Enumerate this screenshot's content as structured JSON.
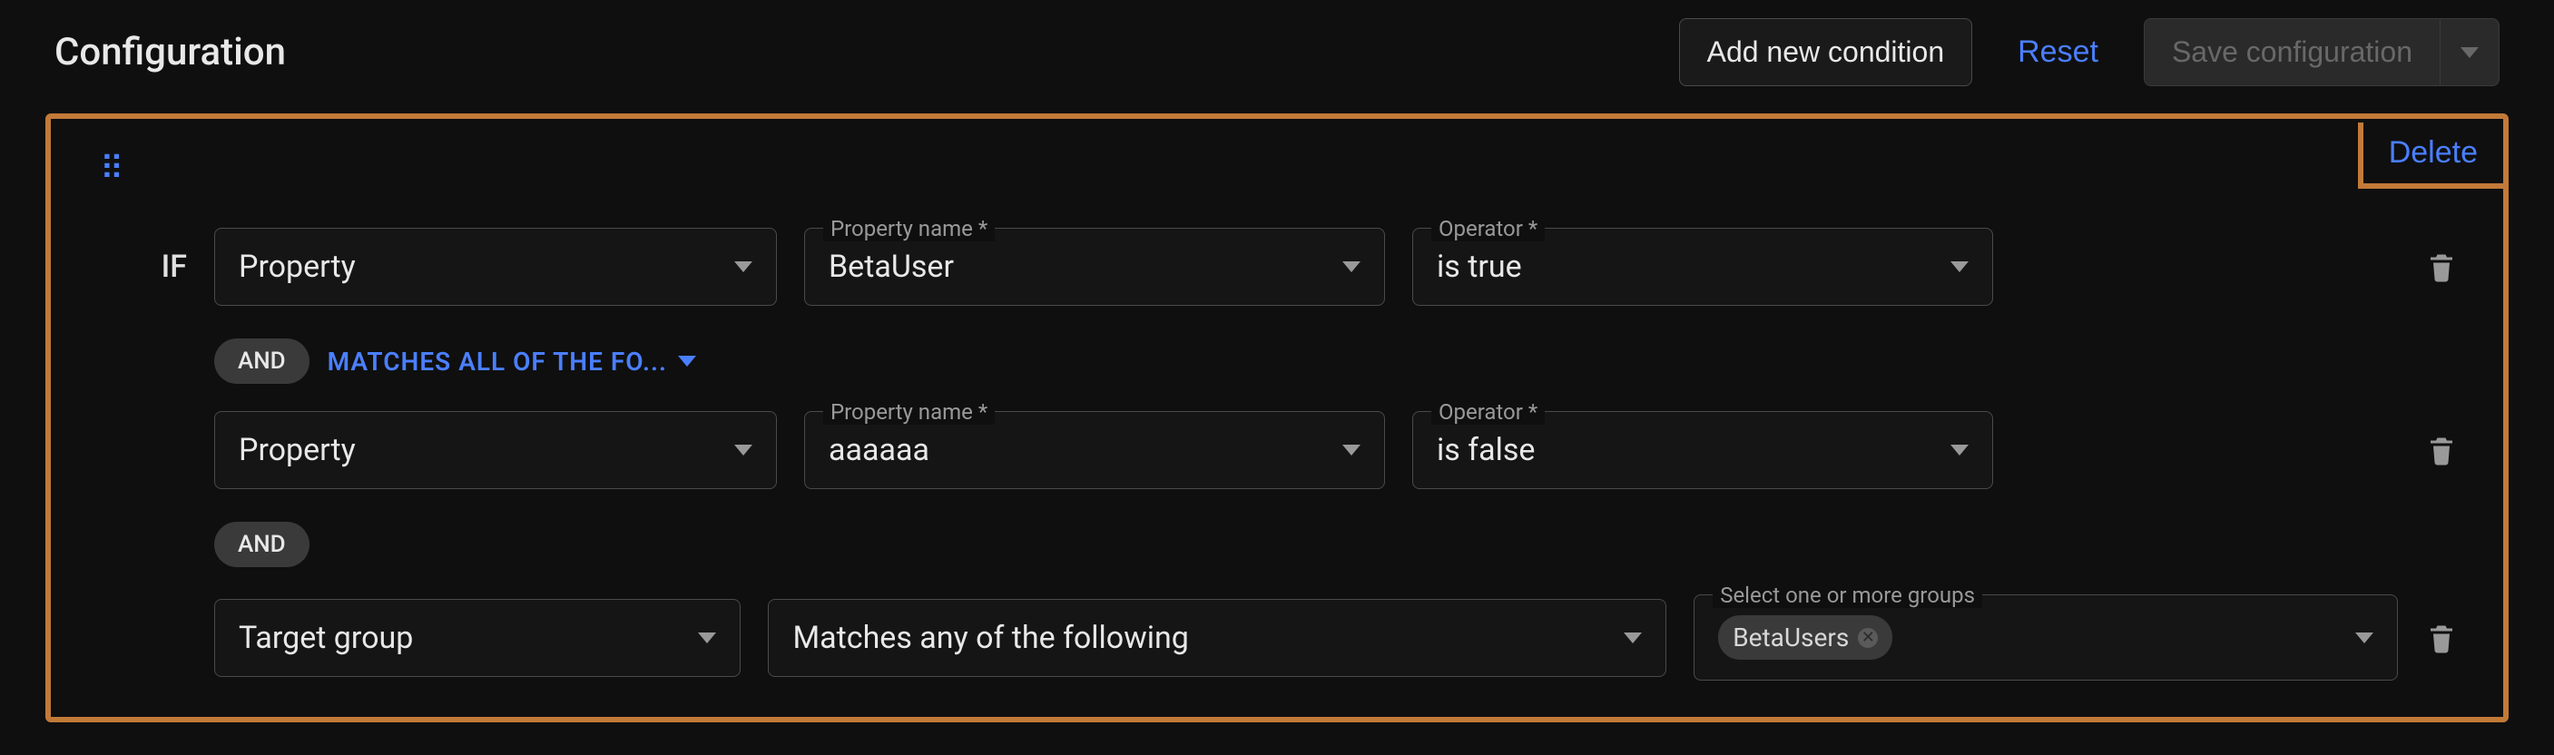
{
  "header": {
    "title": "Configuration",
    "add_button": "Add new condition",
    "reset_button": "Reset",
    "save_button": "Save configuration"
  },
  "block": {
    "delete_label": "Delete",
    "if_label": "IF",
    "and_label": "AND",
    "matches_all_label": "MATCHES ALL OF THE FO...",
    "rows": [
      {
        "type": "Property",
        "prop_label": "Property name *",
        "prop_value": "BetaUser",
        "op_label": "Operator *",
        "op_value": "is true"
      },
      {
        "type": "Property",
        "prop_label": "Property name *",
        "prop_value": "aaaaaa",
        "op_label": "Operator *",
        "op_value": "is false"
      },
      {
        "type": "Target group",
        "target_op": "Matches any of the following",
        "groups_label": "Select one or more groups",
        "groups": [
          "BetaUsers"
        ]
      }
    ]
  }
}
